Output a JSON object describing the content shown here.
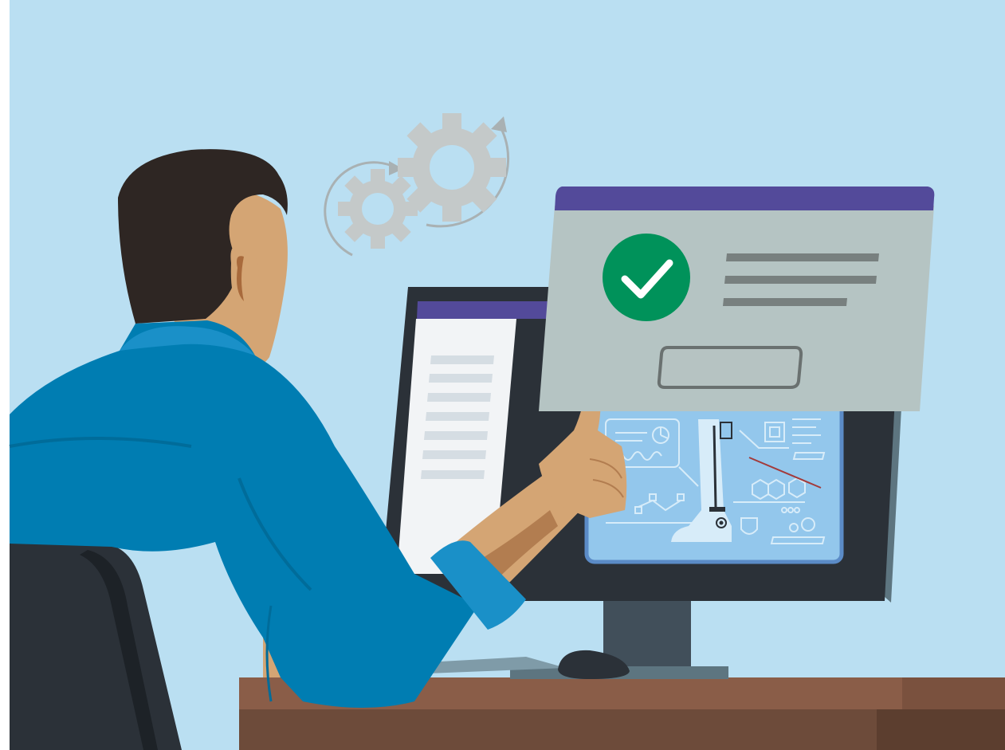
{
  "scene": {
    "description_visible_text": "",
    "colors": {
      "background": "#badff2",
      "wall_border": "#ffffff",
      "desk_top": "#8a5d48",
      "desk_front": "#6d4b3a",
      "desk_dark": "#5c3e2f",
      "monitor_bezel": "#2b3138",
      "monitor_stand": "#414f5a",
      "monitor_base": "#5d7580",
      "window_title_bar": "#534a9a",
      "left_window_bg": "#f2f4f6",
      "left_window_lines": "#d5dde3",
      "right_screen_bg": "#93c7ec",
      "right_screen_border": "#5b8bc7",
      "schematic_lines": "#d7ecf9",
      "dialog_bg": "#b5c4c3",
      "dialog_lines": "#78807f",
      "dialog_button_bg": "#b6c3c2",
      "dialog_button_border": "#6a7170",
      "check_circle": "#00925a",
      "check_mark": "#ffffff",
      "gears": "#c4c9c9",
      "gear_arrows": "#a9b1b3",
      "hair": "#2e2623",
      "skin": "#d4a574",
      "skin_shadow": "#b27d50",
      "ear_inner": "#a86a3c",
      "shirt": "#007db2",
      "shirt_light": "#1a90c8",
      "shirt_dark": "#006c9a",
      "chair": "#2b3138",
      "chair_shadow": "#1d2227",
      "mouse": "#2b3138",
      "keyboard": "#7f9ba8",
      "red_line": "#a33a3a"
    },
    "dialog": {
      "state": "success",
      "icon": "check-icon",
      "text_line_count": 3
    },
    "icons": [
      "gear-icon",
      "refresh-arrow-icon",
      "check-icon",
      "thumbs-up-icon",
      "pie-chart-icon",
      "chip-icon",
      "gear-icon",
      "hexagon-molecule-icon",
      "drop-shield-icon"
    ]
  }
}
